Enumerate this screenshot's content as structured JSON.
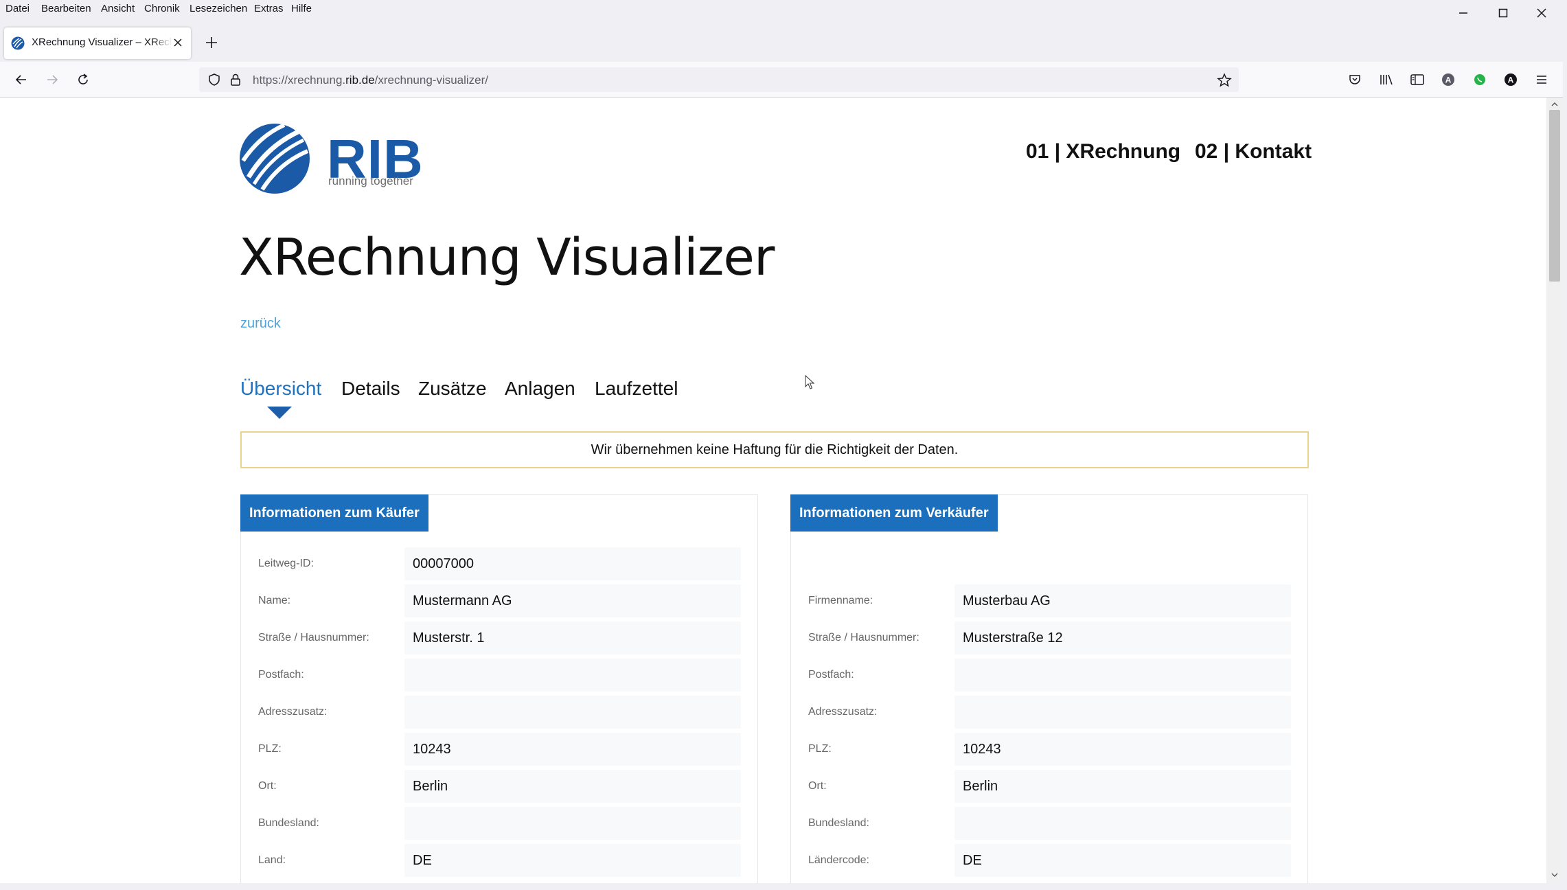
{
  "menubar": {
    "items": [
      "Datei",
      "Bearbeiten",
      "Ansicht",
      "Chronik",
      "Lesezeichen",
      "Extras",
      "Hilfe"
    ]
  },
  "tab": {
    "title": "XRechnung Visualizer – XRechnung"
  },
  "url": {
    "prefix": "https://xrechnung.",
    "domain": "rib.de",
    "path": "/xrechnung-visualizer/"
  },
  "logo": {
    "name": "RIB",
    "tagline": "running together"
  },
  "topnav": {
    "items": [
      "01 | XRechnung",
      "02 | Kontakt"
    ]
  },
  "page": {
    "title": "XRechnung Visualizer",
    "back_label": "zurück"
  },
  "tabs": {
    "items": [
      "Übersicht",
      "Details",
      "Zusätze",
      "Anlagen",
      "Laufzettel"
    ],
    "active": "Übersicht"
  },
  "disclaimer": "Wir übernehmen keine Haftung für die Richtigkeit der Daten.",
  "buyer": {
    "header": "Informationen zum Käufer",
    "rows": [
      {
        "label": "Leitweg-ID:",
        "value": "00007000"
      },
      {
        "label": "Name:",
        "value": "Mustermann AG"
      },
      {
        "label": "Straße / Hausnummer:",
        "value": "Musterstr. 1"
      },
      {
        "label": "Postfach:",
        "value": ""
      },
      {
        "label": "Adresszusatz:",
        "value": ""
      },
      {
        "label": "PLZ:",
        "value": "10243"
      },
      {
        "label": "Ort:",
        "value": "Berlin"
      },
      {
        "label": "Bundesland:",
        "value": ""
      },
      {
        "label": "Land:",
        "value": "DE"
      }
    ]
  },
  "seller": {
    "header": "Informationen zum Verkäufer",
    "rows": [
      {
        "label": "Firmenname:",
        "value": "Musterbau AG"
      },
      {
        "label": "Straße / Hausnummer:",
        "value": "Musterstraße 12"
      },
      {
        "label": "Postfach:",
        "value": ""
      },
      {
        "label": "Adresszusatz:",
        "value": ""
      },
      {
        "label": "PLZ:",
        "value": "10243"
      },
      {
        "label": "Ort:",
        "value": "Berlin"
      },
      {
        "label": "Bundesland:",
        "value": ""
      },
      {
        "label": "Ländercode:",
        "value": "DE"
      }
    ]
  },
  "colors": {
    "accent": "#1c6fbd",
    "link": "#4fa3d6",
    "disclaimer_border": "#e8d48a"
  }
}
